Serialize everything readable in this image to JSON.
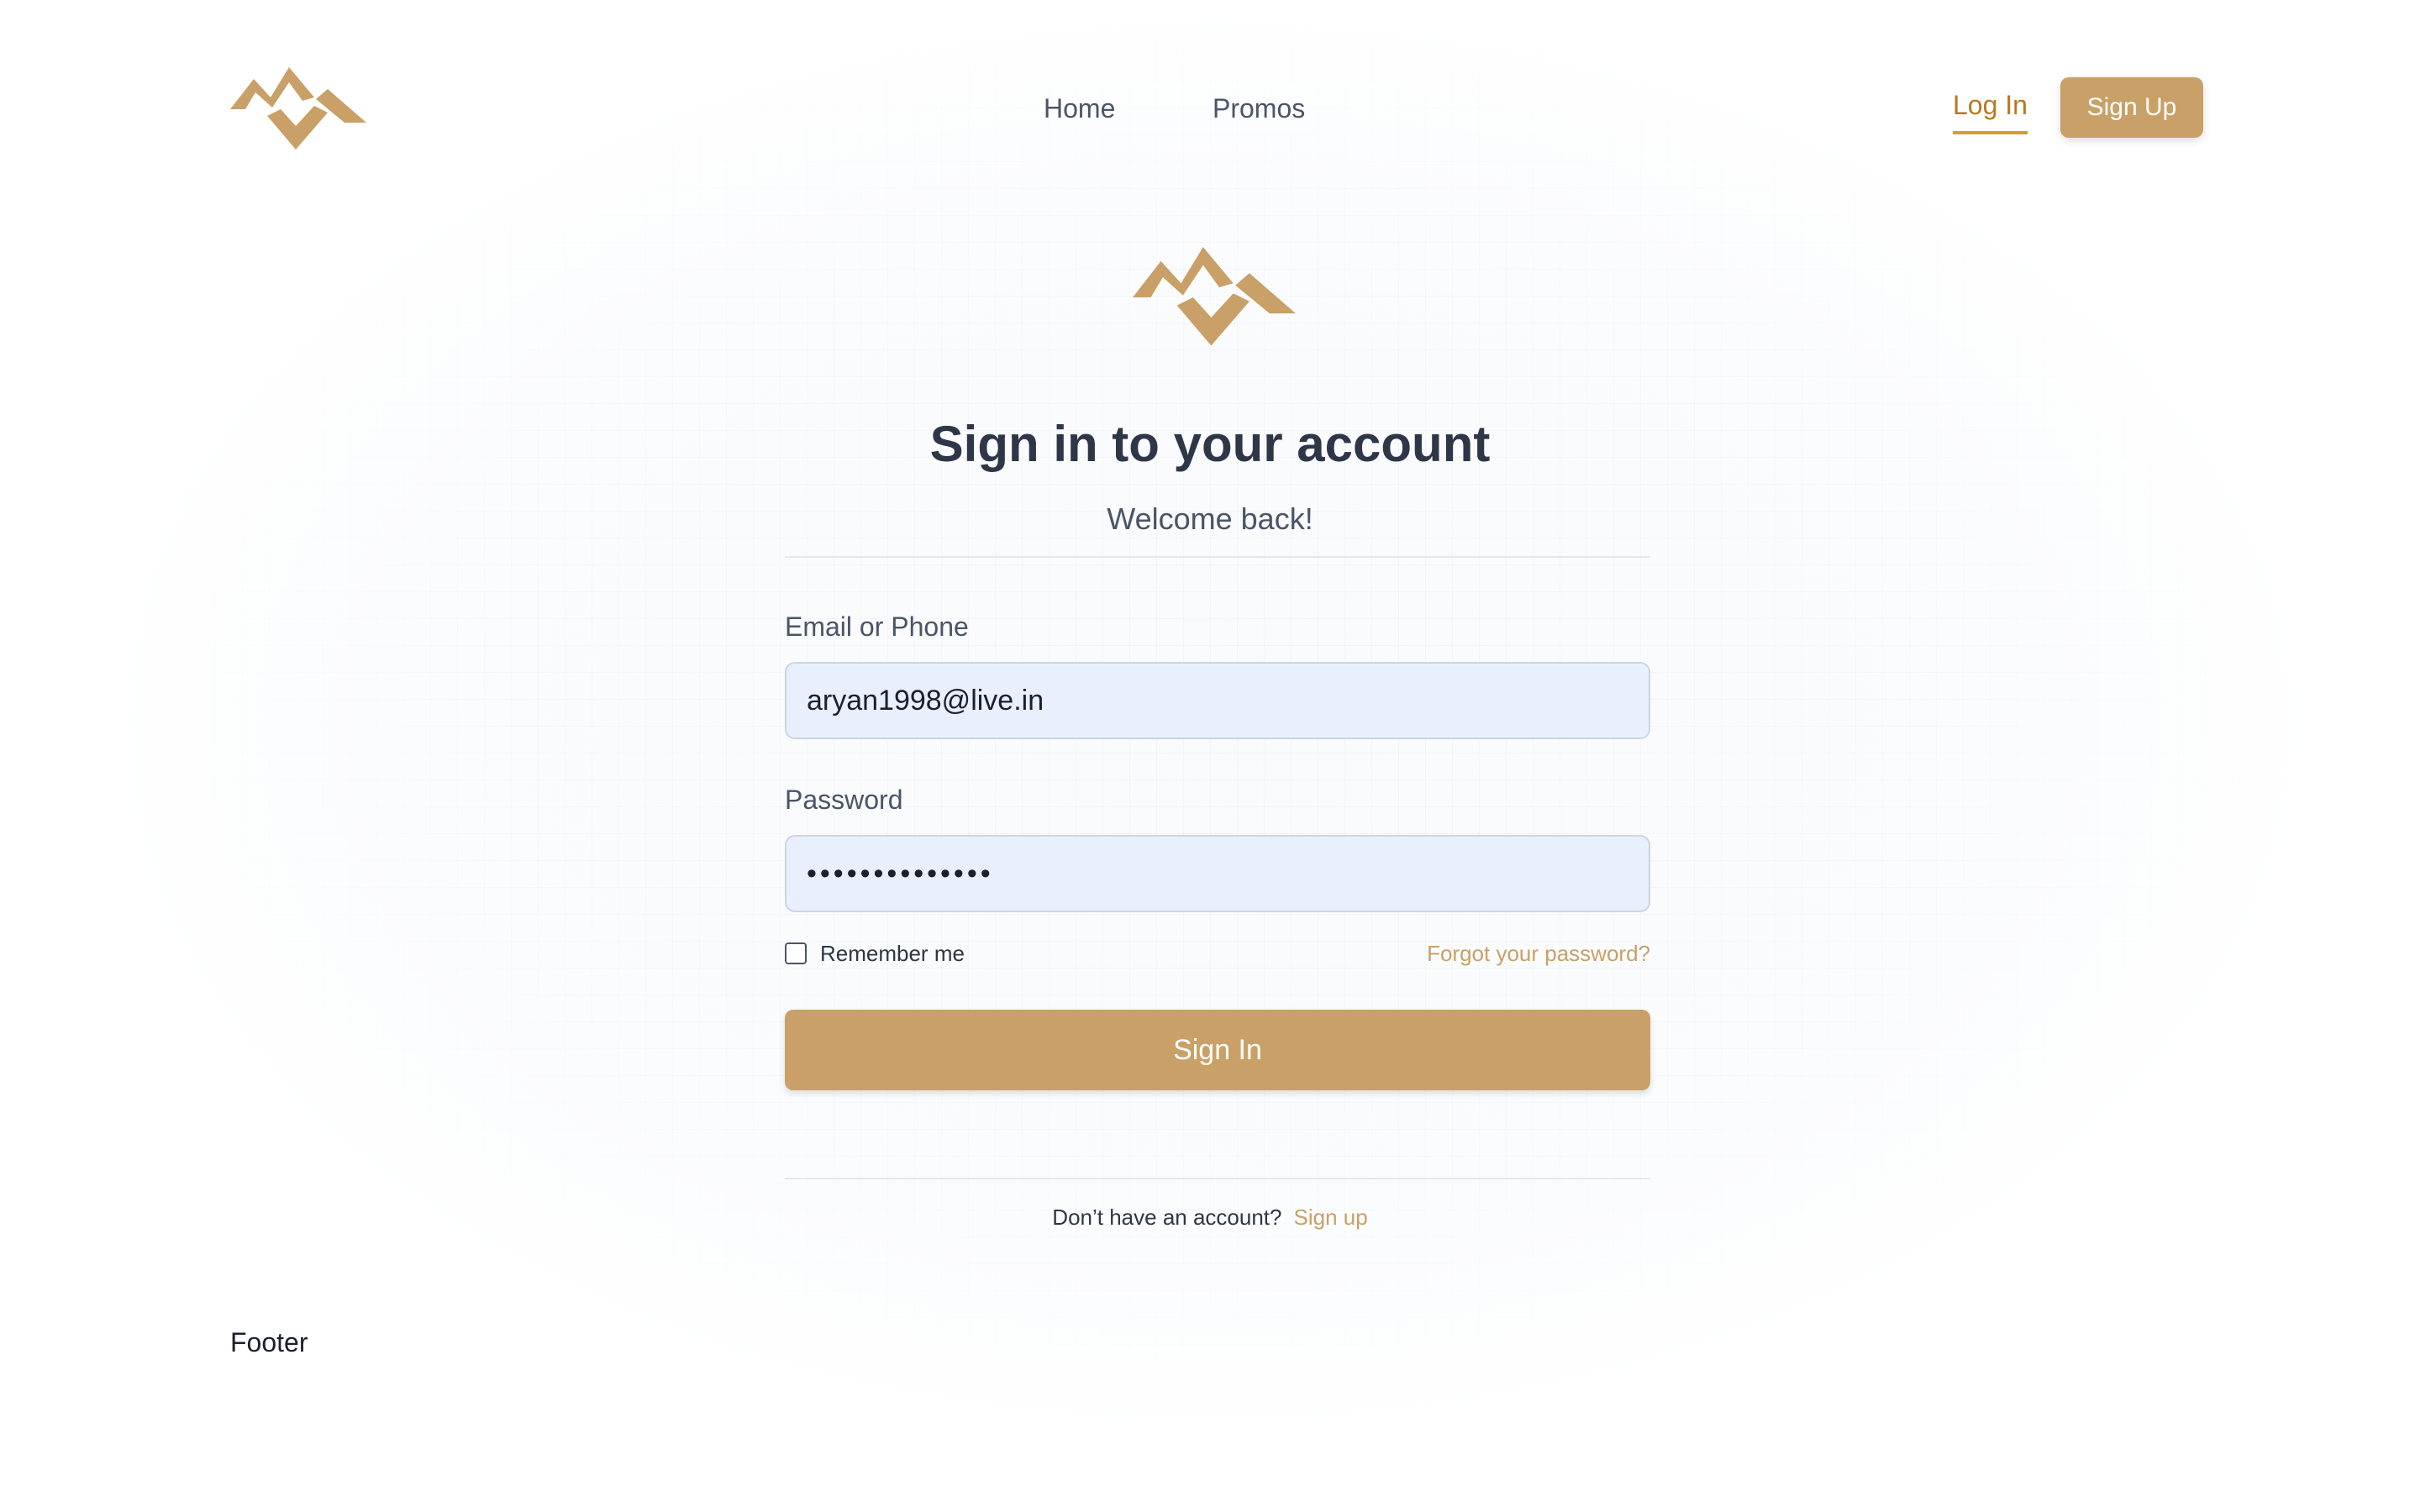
{
  "colors": {
    "brand": "#c9a067",
    "login_accent": "#b7791f",
    "input_bg": "#e8f0fe",
    "text_dark": "#2d3748",
    "text_muted": "#4a5568"
  },
  "header": {
    "logo_icon": "brand-logo-icon",
    "nav": {
      "home": "Home",
      "promos": "Promos"
    },
    "login_label": "Log In",
    "signup_label": "Sign Up"
  },
  "form": {
    "logo_icon": "brand-logo-icon",
    "title": "Sign in to your account",
    "subtitle": "Welcome back!",
    "email_label": "Email or Phone",
    "email_value": "aryan1998@live.in",
    "password_label": "Password",
    "password_value": "••••••••••••••",
    "remember_label": "Remember me",
    "remember_checked": false,
    "forgot_label": "Forgot your password?",
    "submit_label": "Sign In",
    "no_account_text": "Don’t have an account?",
    "signup_link": "Sign up"
  },
  "footer": {
    "text": "Footer"
  }
}
